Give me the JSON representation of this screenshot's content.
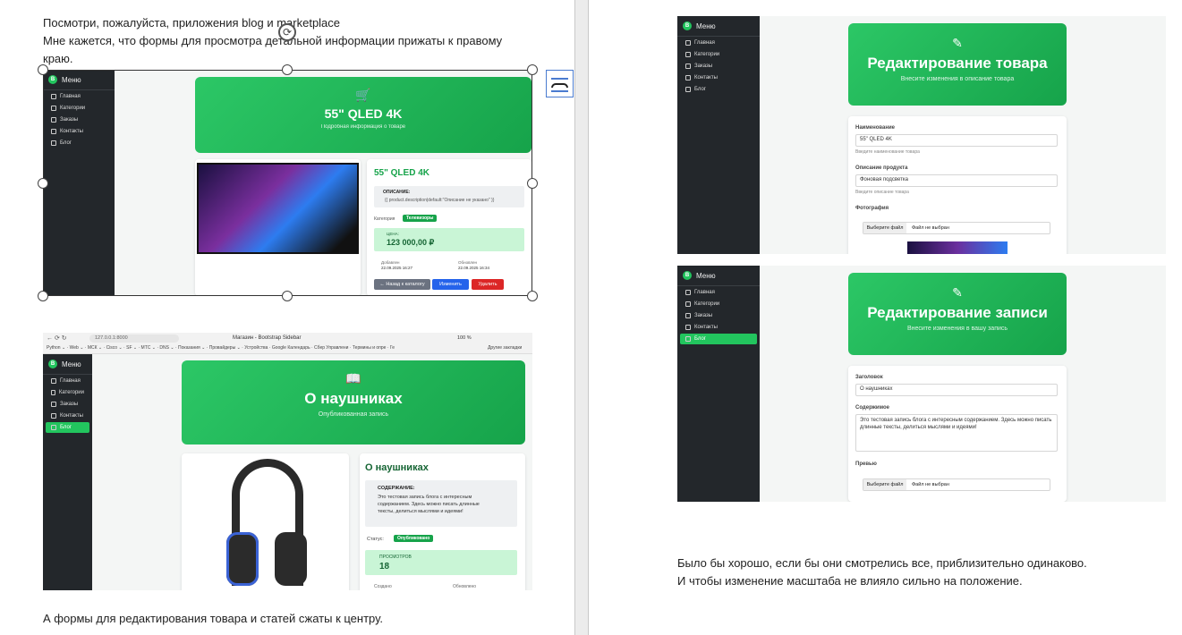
{
  "left_page": {
    "intro_line1": "Посмотри, пожалуйста, приложения blog и marketplace",
    "intro_line2": "Мне кажется, что формы для просмотра детальной информации прижаты к правому",
    "intro_line3": "краю.",
    "bottom_line": "А формы для редактирования товара и статей сжаты к центру."
  },
  "right_page": {
    "closing_line1": "Было бы хорошо, если бы они смотрелись все, приблизительно одинаково.",
    "closing_line2": "И чтобы изменение масштаба не влияло сильно на положение."
  },
  "sidebar": {
    "title": "Меню",
    "logo_letter": "B",
    "items": [
      "Главная",
      "Категории",
      "Заказы",
      "Контакты",
      "Блог"
    ]
  },
  "product_view": {
    "hero_title": "55\" QLED 4K",
    "hero_sub": "Подробная информация о товаре",
    "name": "55\" QLED 4K",
    "desc_label": "ОПИСАНИЕ:",
    "desc_value": "{{ product.description|default:\"Описание не указано\" }}",
    "category_label": "Категория",
    "category_badge": "Телевизоры",
    "price_label": "ЦЕНА:",
    "price_value": "123 000,00 ₽",
    "added_label": "Добавлен",
    "added_value": "22.09.2025 16:27",
    "updated_label": "Обновлен",
    "updated_value": "22.09.2025 16:34",
    "btn_back": "← Назад к каталогу",
    "btn_edit": "Изменить",
    "btn_delete": "Удалить"
  },
  "browser": {
    "url": "127.0.0.1:8000",
    "tab_title": "Магазин - Bootstrap Sidebar",
    "zoom": "100 %",
    "bookmarks": [
      "Python",
      "Web",
      "МСК",
      "Cisco",
      "SF",
      "МТС",
      "DNS",
      "Показания",
      "Провайдеры",
      "Устройства",
      "Google Календарь",
      "Сбер Управлени",
      "Термины и опре",
      "Ге"
    ],
    "other_bookmarks": "Другие закладки"
  },
  "blog_view": {
    "hero_title": "О наушниках",
    "hero_sub": "Опубликованная запись",
    "name": "О наушниках",
    "content_label": "СОДЕРЖАНИЕ:",
    "content_value": "Это тестовая запись блога с интересным содержанием. Здесь можно писать длинные тексты, делиться мыслями и идеями!",
    "status_label": "Статус:",
    "status_badge": "Опубликовано",
    "views_label": "ПРОСМОТРОВ",
    "views_value": "18",
    "created_label": "Создано",
    "updated_label": "Обновлено"
  },
  "product_edit": {
    "hero_title": "Редактирование товара",
    "hero_sub": "Внесите изменения в описание товара",
    "name_label": "Наименование",
    "name_value": "55\" QLED 4K",
    "name_hint": "Введите наименование товара",
    "desc_label": "Описание продукта",
    "desc_value": "Фоновая подсветка",
    "desc_hint": "Введите описание товара",
    "photo_label": "Фотография",
    "file_btn": "Выберите файл",
    "file_none": "Файл не выбран"
  },
  "blog_edit": {
    "hero_title": "Редактирование записи",
    "hero_sub": "Внесите изменения в вашу запись",
    "title_label": "Заголовок",
    "title_value": "О наушниках",
    "content_label": "Содержимое",
    "content_value": "Это тестовая запись блога с интересным содержанием. Здесь можно писать длинные тексты, делиться мыслями и идеями!",
    "preview_label": "Превью",
    "file_btn": "Выберите файл",
    "file_none": "Файл не выбран"
  },
  "colors": {
    "brand_green": "#22c55e",
    "sidebar_bg": "#23272b",
    "blue_btn": "#2563eb",
    "red_btn": "#dc2626"
  }
}
